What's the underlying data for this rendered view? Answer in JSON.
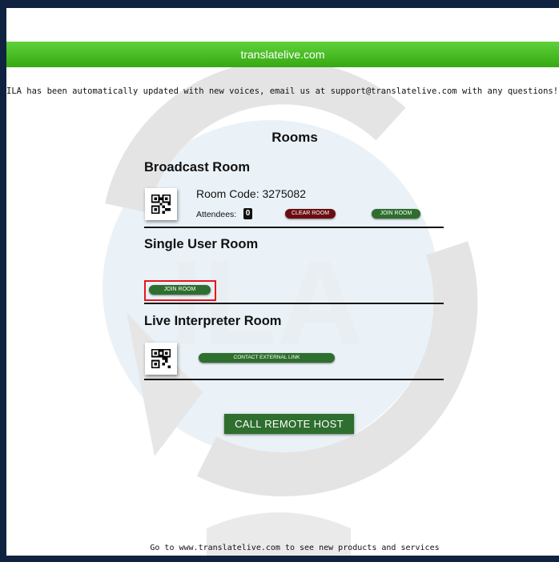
{
  "banner": {
    "site": "translatelive.com"
  },
  "notice": "ILA has been automatically updated with new voices, email us at support@translatelive.com with any questions!",
  "rooms_title": "Rooms",
  "broadcast": {
    "title": "Broadcast Room",
    "room_code": "Room Code: 3275082",
    "attendees_label": "Attendees:",
    "attendees_count": "0",
    "clear_label": "CLEAR ROOM",
    "join_label": "JOIN ROOM"
  },
  "single": {
    "title": "Single User Room",
    "join_label": "JOIN ROOM"
  },
  "interpreter": {
    "title": "Live Interpreter Room",
    "contact_label": "CONTACT EXTERNAL LINK"
  },
  "call_remote": "CALL REMOTE HOST",
  "footer": "Go to www.translatelive.com to see new products and services",
  "watermark_text": "ILA",
  "colors": {
    "banner_green": "#3db318",
    "button_green": "#2e6e2e",
    "button_red": "#6b0d10",
    "highlight": "#e8141b"
  },
  "icons": {
    "qr": "qr-code-icon",
    "watermark": "globe-logo-icon"
  }
}
